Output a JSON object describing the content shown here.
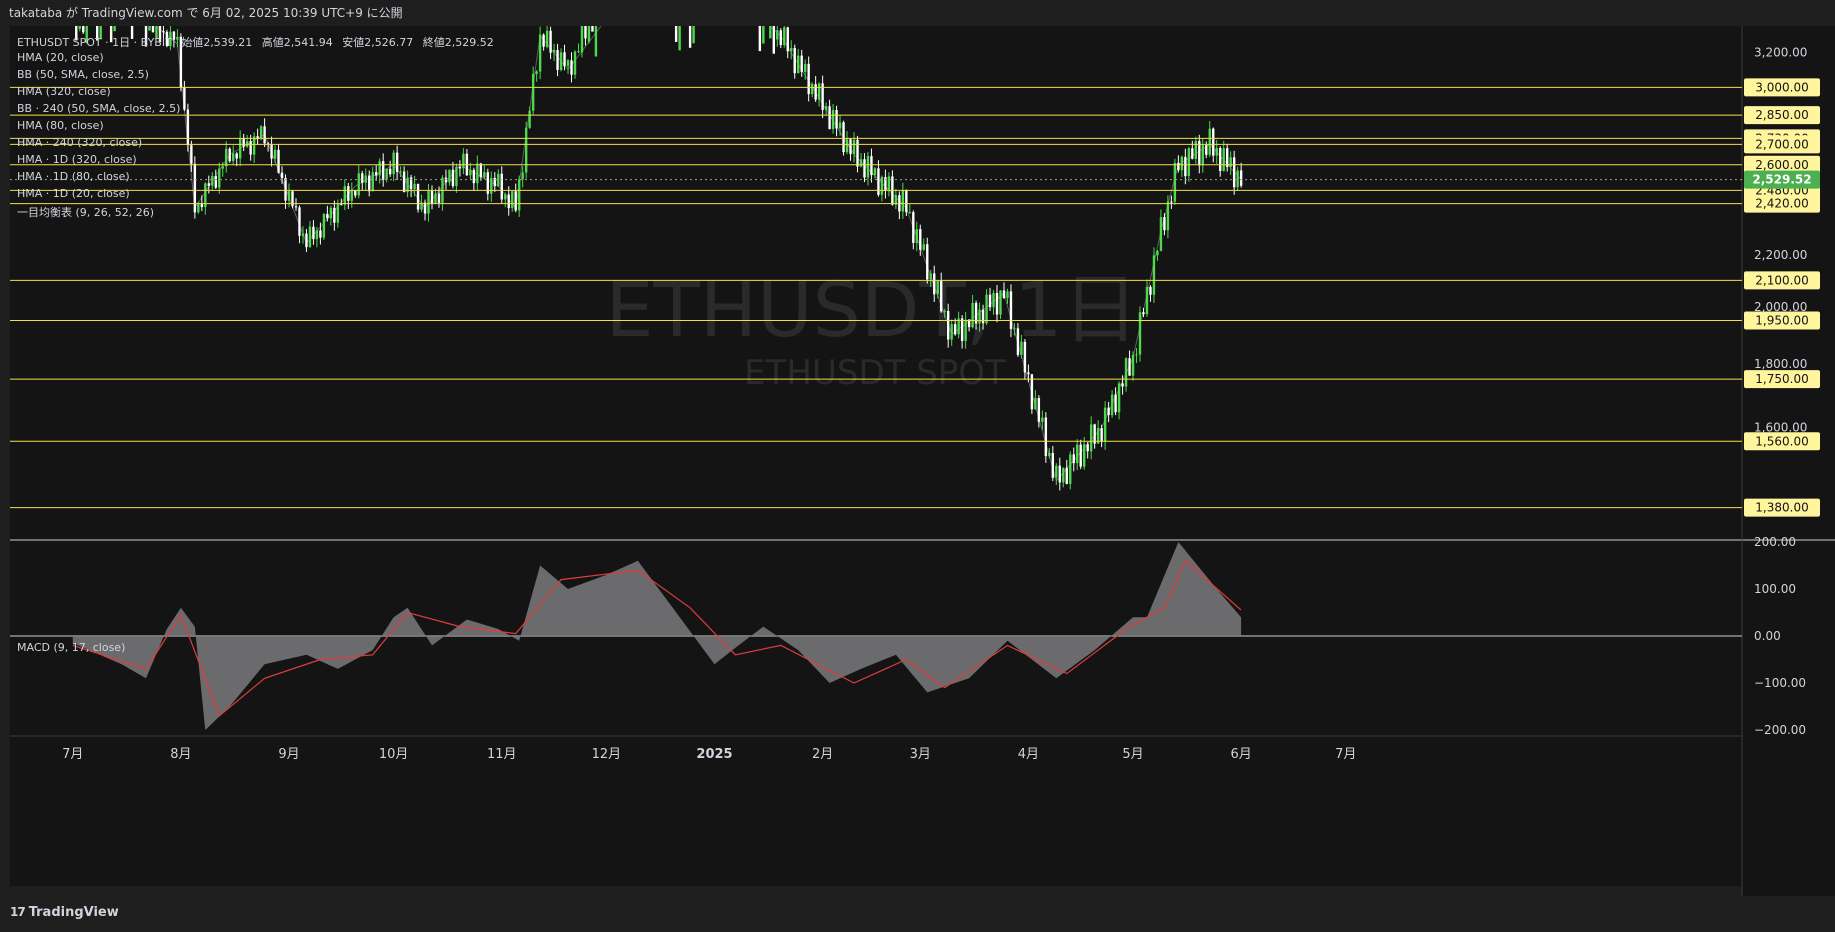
{
  "header": {
    "published_text": "takataba が TradingView.com で 6月 02, 2025 10:39 UTC+9 に公開"
  },
  "symbol_line": {
    "symbol": "ETHUSDT SPOT · 1日 · BYBIT",
    "open_label": "始値",
    "open": "2,539.21",
    "high_label": "高値",
    "high": "2,541.94",
    "low_label": "安値",
    "low": "2,526.77",
    "close_label": "終値",
    "close": "2,529.52"
  },
  "indicators": [
    "HMA (20, close)",
    "BB (50, SMA, close, 2.5)",
    "HMA (320, close)",
    "BB · 240 (50, SMA, close, 2.5)",
    "HMA (80, close)",
    "HMA · 240 (320, close)",
    "HMA · 1D (320, close)",
    "HMA · 1D (80, close)",
    "HMA · 1D (20, close)",
    "一目均衡表 (9, 26, 52, 26)"
  ],
  "watermark": {
    "main": "ETHUSDT, 1日",
    "sub": "ETHUSDT SPOT"
  },
  "macd_label": "MACD (9, 17, close)",
  "footer": {
    "logo_mark": "17",
    "logo_text": "TradingView"
  },
  "colors": {
    "background": "#141414",
    "frame": "#1e1e1e",
    "up_candle": "#4cd94c",
    "down_candle": "#ffffff",
    "level_line": "#f0e048",
    "level_label_bg": "#fff59d",
    "last_price_bg": "#4caf50",
    "hma20": "#e070e0",
    "bb": "#3d7bd6",
    "hma_long": "#5cb85c",
    "hma80": "#5aa0f0",
    "cloud": "#3a3a3a",
    "macd_hist": "#7a7a7e",
    "macd_signal": "#e03c3c"
  },
  "chart_data": {
    "type": "candlestick",
    "title": "ETHUSDT, 1日",
    "x_ticks": [
      "7月",
      "8月",
      "9月",
      "10月",
      "11月",
      "12月",
      "2025",
      "2月",
      "3月",
      "4月",
      "5月",
      "6月",
      "7月"
    ],
    "y_ticks": [
      "3,200.00",
      "2,200.00",
      "2,000.00",
      "1,800.00",
      "1,600.00"
    ],
    "ylim": [
      1300,
      3360
    ],
    "log_scale": true,
    "horizontal_levels": [
      3000,
      2850,
      2730,
      2700,
      2600,
      2480,
      2420,
      2100,
      1950,
      1750,
      1560,
      1380
    ],
    "horizontal_level_labels": [
      "3,000.00",
      "2,850.00",
      "2,730.00",
      "2,700.00",
      "2,600.00",
      "2,480.00",
      "2,420.00",
      "2,100.00",
      "1,950.00",
      "1,750.00",
      "1,560.00",
      "1,380.00"
    ],
    "last_price": 2529.52,
    "last_price_label": "2,529.52",
    "price_path": [
      [
        "2024-07-01",
        3400
      ],
      [
        "2024-07-20",
        3450
      ],
      [
        "2024-07-31",
        3250
      ],
      [
        "2024-08-05",
        2400
      ],
      [
        "2024-08-15",
        2650
      ],
      [
        "2024-08-25",
        2750
      ],
      [
        "2024-09-06",
        2250
      ],
      [
        "2024-09-20",
        2500
      ],
      [
        "2024-10-01",
        2600
      ],
      [
        "2024-10-10",
        2400
      ],
      [
        "2024-10-20",
        2600
      ],
      [
        "2024-10-31",
        2500
      ],
      [
        "2024-11-05",
        2400
      ],
      [
        "2024-11-12",
        3300
      ],
      [
        "2024-11-20",
        3100
      ],
      [
        "2024-12-06",
        3900
      ],
      [
        "2024-12-20",
        3400
      ],
      [
        "2025-01-07",
        3600
      ],
      [
        "2025-01-20",
        3300
      ],
      [
        "2025-02-03",
        2850
      ],
      [
        "2025-02-10",
        2650
      ],
      [
        "2025-02-25",
        2400
      ],
      [
        "2025-03-10",
        1900
      ],
      [
        "2025-03-25",
        2050
      ],
      [
        "2025-04-09",
        1450
      ],
      [
        "2025-04-22",
        1600
      ],
      [
        "2025-05-01",
        1820
      ],
      [
        "2025-05-09",
        2300
      ],
      [
        "2025-05-14",
        2600
      ],
      [
        "2025-05-23",
        2700
      ],
      [
        "2025-06-01",
        2530
      ]
    ],
    "series": [
      {
        "name": "HMA (20, close)",
        "values": []
      },
      {
        "name": "BB (50, SMA, close, 2.5)",
        "values": []
      },
      {
        "name": "HMA (80, close)",
        "values": []
      },
      {
        "name": "HMA (320, close)",
        "values": []
      },
      {
        "name": "一目均衡表 (9, 26, 52, 26)",
        "values": []
      }
    ],
    "macd": {
      "name": "MACD (9, 17, close)",
      "y_ticks": [
        "200.00",
        "100.00",
        "0.00",
        "−100.00",
        "−200.00"
      ],
      "ylim": [
        -230,
        230
      ],
      "histogram": [
        [
          "2024-07-01",
          -15
        ],
        [
          "2024-07-15",
          -60
        ],
        [
          "2024-07-22",
          -90
        ],
        [
          "2024-07-28",
          15
        ],
        [
          "2024-08-01",
          60
        ],
        [
          "2024-08-05",
          20
        ],
        [
          "2024-08-08",
          -200
        ],
        [
          "2024-08-15",
          -150
        ],
        [
          "2024-08-25",
          -60
        ],
        [
          "2024-09-06",
          -40
        ],
        [
          "2024-09-15",
          -70
        ],
        [
          "2024-09-25",
          -30
        ],
        [
          "2024-10-01",
          40
        ],
        [
          "2024-10-05",
          60
        ],
        [
          "2024-10-12",
          -20
        ],
        [
          "2024-10-22",
          35
        ],
        [
          "2024-10-31",
          15
        ],
        [
          "2024-11-06",
          -10
        ],
        [
          "2024-11-12",
          150
        ],
        [
          "2024-11-20",
          100
        ],
        [
          "2024-12-01",
          130
        ],
        [
          "2024-12-10",
          160
        ],
        [
          "2024-12-20",
          60
        ],
        [
          "2025-01-01",
          -60
        ],
        [
          "2025-01-07",
          -25
        ],
        [
          "2025-01-15",
          20
        ],
        [
          "2025-01-25",
          -30
        ],
        [
          "2025-02-03",
          -100
        ],
        [
          "2025-02-12",
          -70
        ],
        [
          "2025-02-22",
          -40
        ],
        [
          "2025-03-03",
          -120
        ],
        [
          "2025-03-15",
          -90
        ],
        [
          "2025-03-26",
          -10
        ],
        [
          "2025-04-09",
          -90
        ],
        [
          "2025-04-20",
          -30
        ],
        [
          "2025-05-01",
          40
        ],
        [
          "2025-05-05",
          40
        ],
        [
          "2025-05-14",
          200
        ],
        [
          "2025-05-25",
          100
        ],
        [
          "2025-06-01",
          40
        ]
      ],
      "signal": [
        [
          "2024-07-01",
          -20
        ],
        [
          "2024-07-22",
          -70
        ],
        [
          "2024-08-01",
          45
        ],
        [
          "2024-08-12",
          -170
        ],
        [
          "2024-08-25",
          -90
        ],
        [
          "2024-09-10",
          -50
        ],
        [
          "2024-09-25",
          -40
        ],
        [
          "2024-10-05",
          50
        ],
        [
          "2024-10-20",
          20
        ],
        [
          "2024-11-05",
          5
        ],
        [
          "2024-11-18",
          120
        ],
        [
          "2024-12-10",
          140
        ],
        [
          "2024-12-25",
          60
        ],
        [
          "2025-01-07",
          -40
        ],
        [
          "2025-01-20",
          -20
        ],
        [
          "2025-02-10",
          -100
        ],
        [
          "2025-02-25",
          -50
        ],
        [
          "2025-03-08",
          -110
        ],
        [
          "2025-03-26",
          -20
        ],
        [
          "2025-04-12",
          -80
        ],
        [
          "2025-04-30",
          20
        ],
        [
          "2025-05-10",
          60
        ],
        [
          "2025-05-16",
          160
        ],
        [
          "2025-06-01",
          55
        ]
      ]
    }
  }
}
